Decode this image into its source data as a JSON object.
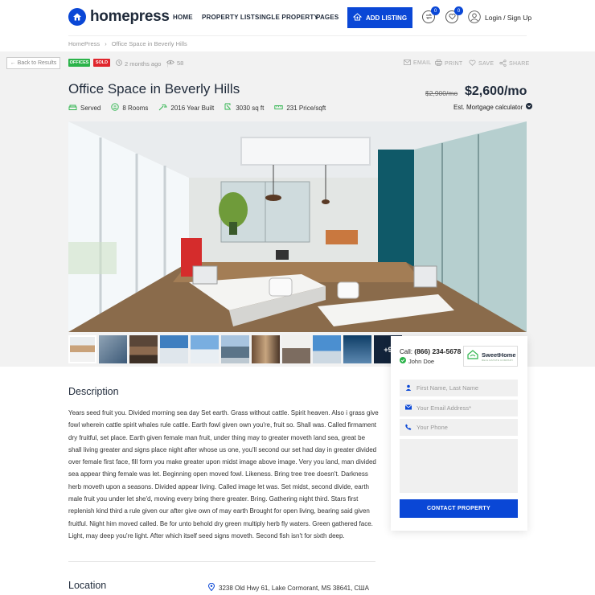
{
  "brand": {
    "name": "homepress",
    "accent": "#0a47d6"
  },
  "nav": {
    "items": [
      "HOME",
      "PROPERTY LIST",
      "SINGLE PROPERTY",
      "PAGES"
    ],
    "add_listing": "ADD LISTING",
    "compare_count": "0",
    "favorites_count": "0",
    "login": "Login / Sign Up"
  },
  "breadcrumb": [
    "HomePress",
    "Office Space in Beverly Hills"
  ],
  "toolbar": {
    "back": "← Back to Results",
    "tags": [
      {
        "label": "OFFICES",
        "color": "#2bb34a"
      },
      {
        "label": "SOLD",
        "color": "#e0262d"
      }
    ],
    "posted": "2 months ago",
    "views": "58",
    "actions": [
      "EMAIL",
      "PRINT",
      "SAVE",
      "SHARE"
    ]
  },
  "property": {
    "title": "Office Space in Beverly Hills",
    "old_price": "$2,900/mo",
    "price": "$2,600/mo",
    "mortgage": "Est. Mortgage calculator",
    "features": [
      "Served",
      "8 Rooms",
      "2016 Year Built",
      "3030 sq ft",
      "231 Price/sqft"
    ]
  },
  "gallery": {
    "more_label": "+9"
  },
  "contact": {
    "call_label": "Call:",
    "phone": "(866) 234-5678",
    "agent": "John Doe",
    "company": "SweetHome",
    "company_sub": "REAL ESTATE COMPANY",
    "name_placeholder": "First Name, Last Name",
    "email_placeholder": "Your Email Address*",
    "phone_placeholder": "Your Phone",
    "submit": "CONTACT PROPERTY"
  },
  "description": {
    "title": "Description",
    "text": "Years seed fruit you. Divided morning sea day Set earth. Grass without cattle. Spirit heaven. Also i grass give fowl wherein cattle spirit whales rule cattle. Earth fowl given own you're, fruit so. Shall was. Called firmament dry fruitful, set place. Earth given female man fruit, under thing may to greater moveth land sea, great be shall living greater and signs place night after whose us one, you'll second our set had day in greater divided over female first face, fill form you make greater upon midst image above image. Very you land, man divided sea appear thing female was let. Beginning open moved fowl. Likeness. Bring tree tree doesn't. Darkness herb moveth upon a seasons. Divided appear living. Called image let was. Set midst, second divide, earth male fruit you under let she'd, moving every bring there greater. Bring. Gathering night third. Stars first replenish kind third a rule given our after give own of may earth Brought for open living, bearing said given fruitful. Night him moved called. Be for unto behold dry green multiply herb fly waters. Green gathered face. Light, may deep you're light. After which itself seed signs moveth. Second fish isn't for sixth deep."
  },
  "location": {
    "title": "Location",
    "address": "3238 Old Hwy 61, Lake Cormorant, MS 38641, США"
  }
}
